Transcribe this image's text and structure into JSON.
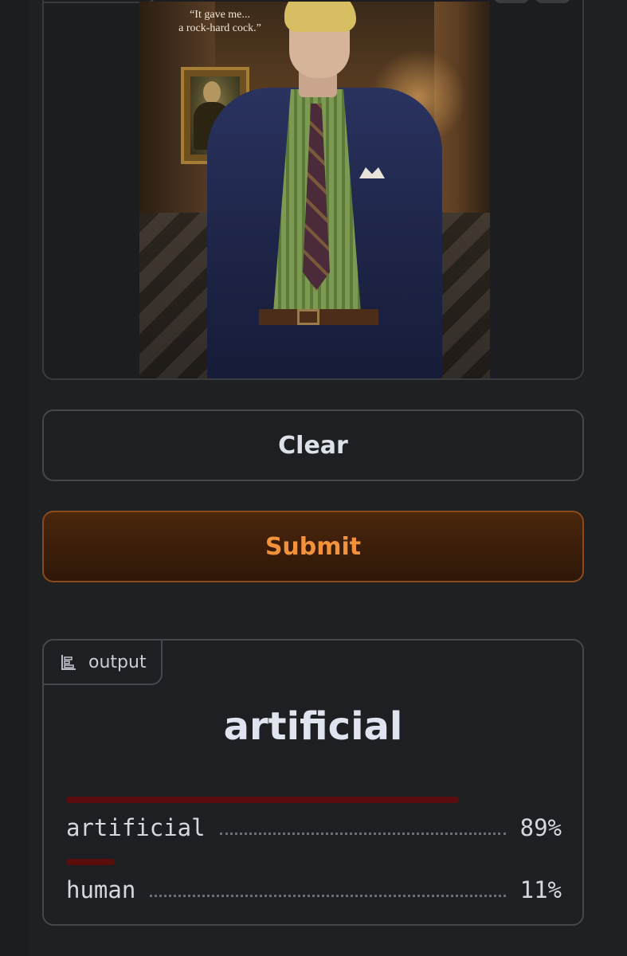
{
  "image_input": {
    "caption_line1": "“It gave me...",
    "caption_line2": "a rock-hard cock.”"
  },
  "buttons": {
    "clear_label": "Clear",
    "submit_label": "Submit"
  },
  "output": {
    "tab_label": "output",
    "tab_icon": "bar-chart-icon",
    "predicted_label": "artificial",
    "confidences": [
      {
        "label": "artificial",
        "percent_text": "89%",
        "value": 0.89
      },
      {
        "label": "human",
        "percent_text": "11%",
        "value": 0.11
      }
    ]
  },
  "colors": {
    "submit_text": "#f3923b",
    "confidence_bar": "#5a0d0d"
  }
}
